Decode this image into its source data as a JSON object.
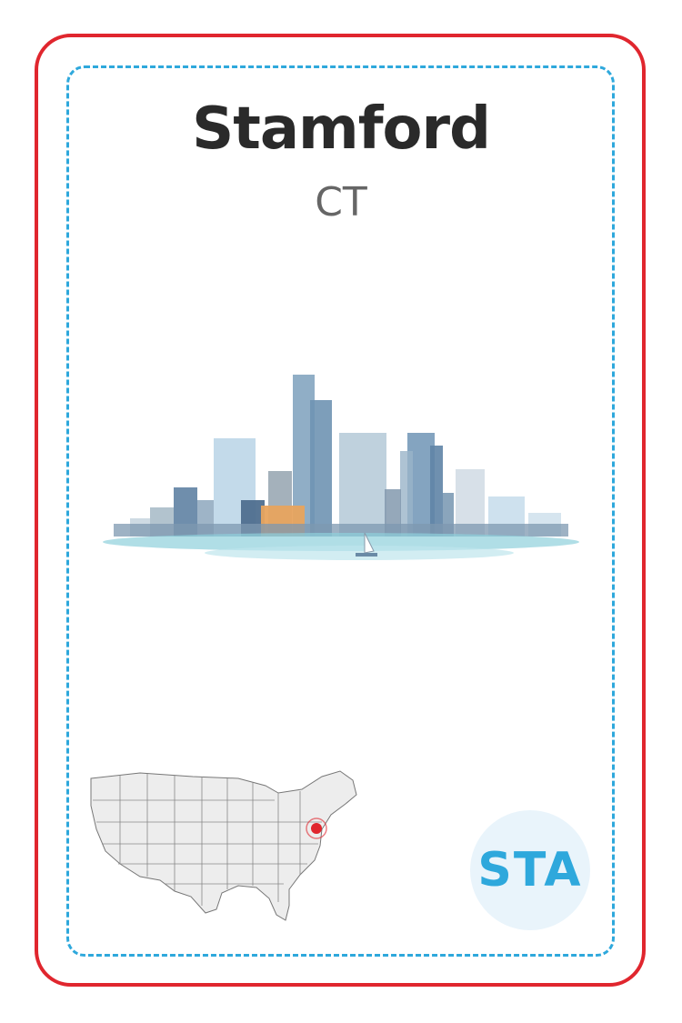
{
  "card": {
    "city": "Stamford",
    "state": "CT",
    "code": "STA"
  },
  "colors": {
    "border": "#e0262e",
    "dashed": "#2ea8dc",
    "title": "#2a2a2a",
    "subtitle": "#666666",
    "code": "#2ea8dc",
    "badge_bg": "#e9f4fb",
    "marker": "#e0262e"
  },
  "icons": {
    "skyline": "watercolor-city-skyline",
    "map": "us-map-with-location-marker",
    "marker": "location-pin-icon"
  }
}
